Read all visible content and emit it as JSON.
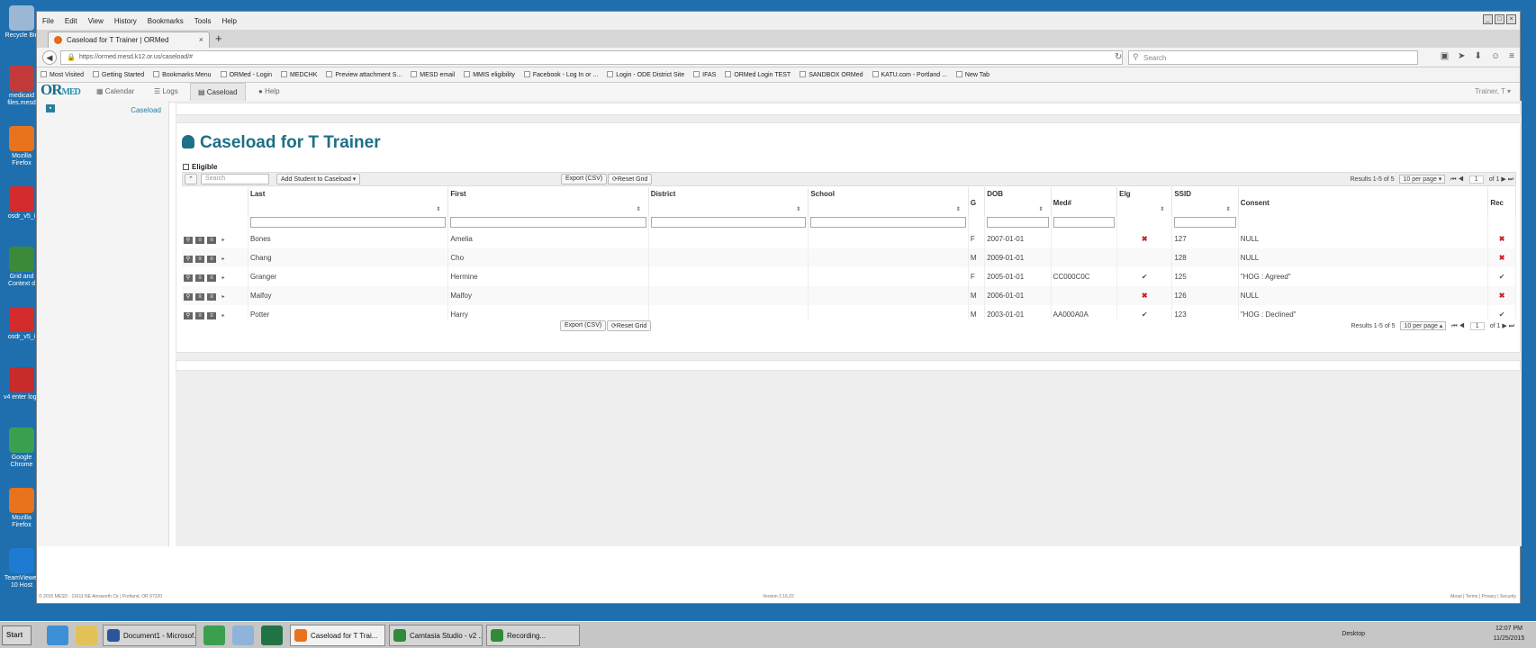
{
  "desktop": {
    "icons": [
      {
        "label": "Recycle Bin",
        "color": "#9bb7d4"
      },
      {
        "label": "medicaid files.mesd",
        "color": "#c23a3a"
      },
      {
        "label": "Mozilla Firefox",
        "color": "#e8731c"
      },
      {
        "label": "osdr_v5_i",
        "color": "#d32b2b"
      },
      {
        "label": "Grid and Context d",
        "color": "#3a8a3a"
      },
      {
        "label": "osdr_v5_i",
        "color": "#d32b2b"
      },
      {
        "label": "v4 enter logs",
        "color": "#c92a2a"
      },
      {
        "label": "Google Chrome",
        "color": "#3aa050"
      },
      {
        "label": "Mozilla Firefox",
        "color": "#e8731c"
      },
      {
        "label": "TeamViewer 10 Host",
        "color": "#1f7ad1"
      }
    ]
  },
  "browser": {
    "menu": [
      "File",
      "Edit",
      "View",
      "History",
      "Bookmarks",
      "Tools",
      "Help"
    ],
    "tab_title": "Caseload for T Trainer | ORMed",
    "url": "https://ormed.mesd.k12.or.us/caseload/#",
    "search_placeholder": "Search",
    "bookmarks": [
      "Most Visited",
      "Getting Started",
      "Bookmarks Menu",
      "ORMed - Login",
      "MEDCHK",
      "Preview attachment S...",
      "MESD email",
      "MMIS eligibility",
      "Facebook - Log In or ...",
      "Login - ODE District Site",
      "IFAS",
      "ORMed Login TEST",
      "SANDBOX ORMed",
      "KATU.com - Portland ...",
      "New Tab"
    ]
  },
  "app": {
    "logo_main": "OR",
    "logo_sub": "MED",
    "nav": {
      "calendar": "Calendar",
      "logs": "Logs",
      "caseload": "Caseload",
      "help": "Help"
    },
    "user": "Trainer, T",
    "sidebar_label": "Caseload",
    "title": "Caseload for T Trainer",
    "eligible_label": "Eligible",
    "search_placeholder": "Search",
    "add_student": "Add Student to Caseload",
    "export": "Export (CSV)",
    "reset": "Reset Grid",
    "results": "Results 1-5 of 5",
    "per_page": "10 per page",
    "page": "1",
    "of_pages": "of 1",
    "columns": [
      "Last",
      "First",
      "District",
      "School",
      "G",
      "DOB",
      "Med#",
      "Elg",
      "SSID",
      "Consent",
      "Rec"
    ],
    "rows": [
      {
        "last": "Bones",
        "first": "Amelia",
        "district": "",
        "school": "",
        "g": "F",
        "dob": "2007-01-01",
        "med": "",
        "elg": "✖",
        "ssid": "127",
        "consent": "NULL",
        "rec": "✖"
      },
      {
        "last": "Chang",
        "first": "Cho",
        "district": "",
        "school": "",
        "g": "M",
        "dob": "2009-01-01",
        "med": "",
        "elg": "",
        "ssid": "128",
        "consent": "NULL",
        "rec": "✖"
      },
      {
        "last": "Granger",
        "first": "Hermine",
        "district": "",
        "school": "",
        "g": "F",
        "dob": "2005-01-01",
        "med": "CC000C0C",
        "elg": "✔",
        "ssid": "125",
        "consent": "\"HOG : Agreed\"",
        "rec": "✔"
      },
      {
        "last": "Malfoy",
        "first": "Malfoy",
        "district": "",
        "school": "",
        "g": "M",
        "dob": "2006-01-01",
        "med": "",
        "elg": "✖",
        "ssid": "126",
        "consent": "NULL",
        "rec": "✖"
      },
      {
        "last": "Potter",
        "first": "Harry",
        "district": "",
        "school": "",
        "g": "M",
        "dob": "2003-01-01",
        "med": "AA000A0A",
        "elg": "✔",
        "ssid": "123",
        "consent": "\"HOG : Declined\"",
        "rec": "✔"
      }
    ],
    "footer_left": "© 2015 MESD · 11611 NE Ainsworth Cir | Portland, OR 97220",
    "footer_mid": "Version 2.16.22",
    "footer_right": "About | Terms | Privacy | Security"
  },
  "taskbar": {
    "start": "Start",
    "tasks": [
      "Document1 - Microsof...",
      "Caseload for T Trai...",
      "Camtasia Studio - v2 ...",
      "Recording..."
    ],
    "desktop": "Desktop",
    "time": "12:07 PM",
    "date": "11/25/2015"
  }
}
